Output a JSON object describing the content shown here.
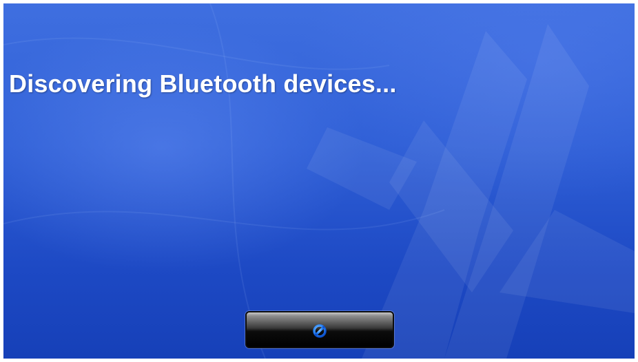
{
  "status": {
    "message": "Discovering Bluetooth devices..."
  },
  "cancel_button": {
    "icon": "cancel-icon",
    "icon_color": "#2f8cff"
  },
  "colors": {
    "background_top": "#3f6fe0",
    "background_bottom": "#1640b8",
    "text": "#ffffff"
  }
}
